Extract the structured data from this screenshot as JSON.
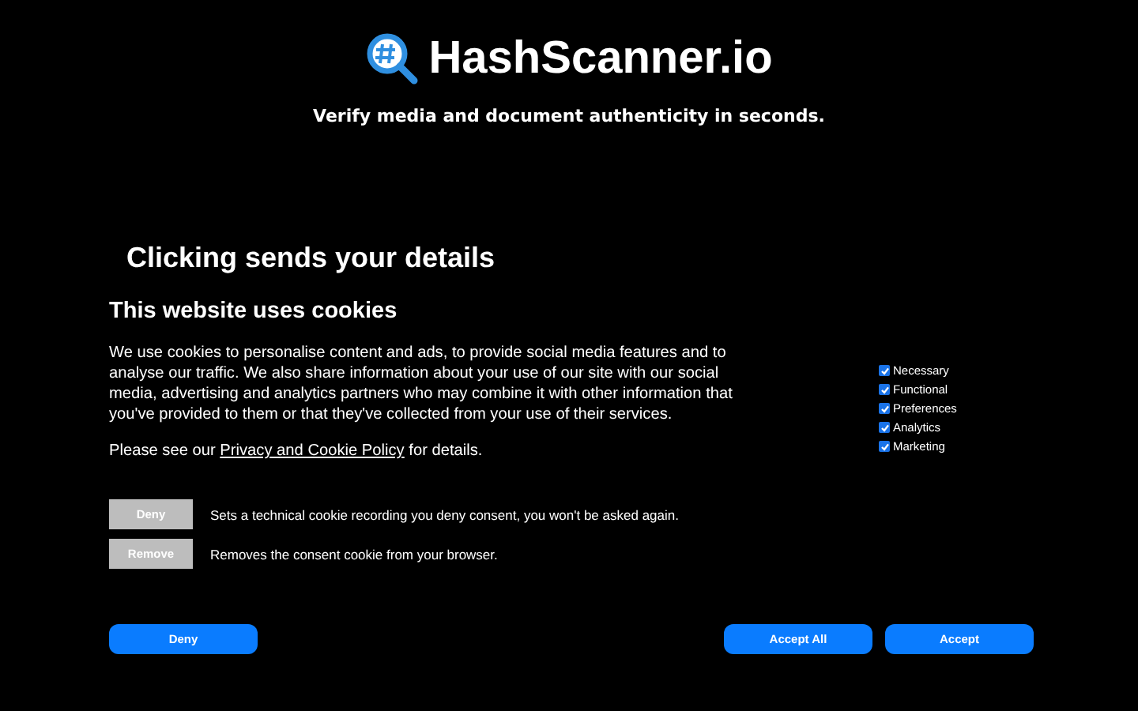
{
  "header": {
    "brand": "HashScanner.io",
    "tagline": "Verify media and document authenticity in seconds."
  },
  "heading": "Clicking sends your details",
  "cookie_dialog": {
    "title": "This website uses cookies",
    "description": "We use cookies to personalise content and ads, to provide social media features and to analyse our traffic. We also share information about your use of our site with our social media, advertising and analytics partners who may combine it with other information that you've provided to them or that they've collected from your use of their services.",
    "policy_before": "Please see our",
    "policy_link": "Privacy and Cookie Policy",
    "policy_after": "for details.",
    "categories": [
      {
        "label": "Necessary",
        "checked": true
      },
      {
        "label": "Functional",
        "checked": true
      },
      {
        "label": "Preferences",
        "checked": true
      },
      {
        "label": "Analytics",
        "checked": true
      },
      {
        "label": "Marketing",
        "checked": true
      }
    ],
    "actions": [
      {
        "button": "Deny",
        "description": "Sets a technical cookie recording you deny consent, you won't be asked again."
      },
      {
        "button": "Remove",
        "description": "Removes the consent cookie from your browser."
      }
    ],
    "left_buttons": [
      "Deny"
    ],
    "right_buttons": [
      "Accept All",
      "Accept"
    ]
  }
}
